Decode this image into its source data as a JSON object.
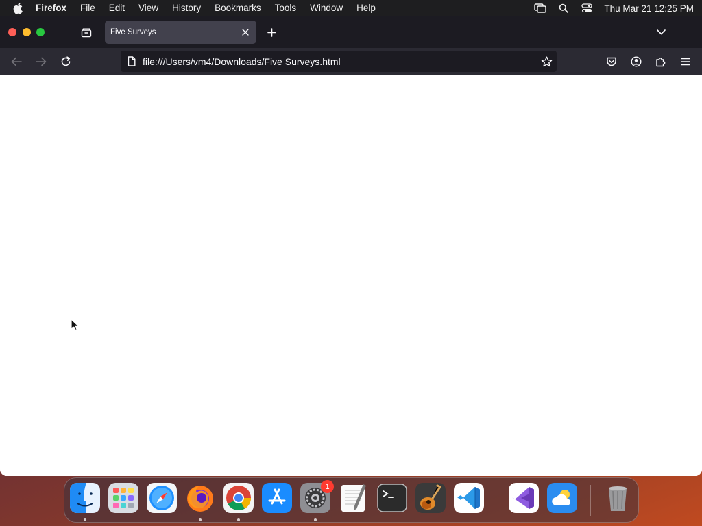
{
  "menubar": {
    "app_name": "Firefox",
    "menus": [
      "File",
      "Edit",
      "View",
      "History",
      "Bookmarks",
      "Tools",
      "Window",
      "Help"
    ],
    "clock": "Thu Mar 21  12:25 PM"
  },
  "browser": {
    "tab": {
      "title": "Five Surveys"
    },
    "url": "file:///Users/vm4/Downloads/Five Surveys.html"
  },
  "dock": {
    "apps": [
      "Finder",
      "Launchpad",
      "Safari",
      "Firefox",
      "Chrome",
      "App Store",
      "System Settings",
      "TextEdit",
      "Terminal",
      "GarageBand",
      "Visual Studio Code",
      "Visual Studio",
      "Weather",
      "Trash"
    ],
    "system_settings_badge": "1"
  },
  "colors": {
    "menubar_bg": "#1e1e20",
    "tabbar_bg": "#1c1b22",
    "navbar_bg": "#2b2a33",
    "active_tab_bg": "#42414d",
    "content_bg": "#ffffff"
  }
}
